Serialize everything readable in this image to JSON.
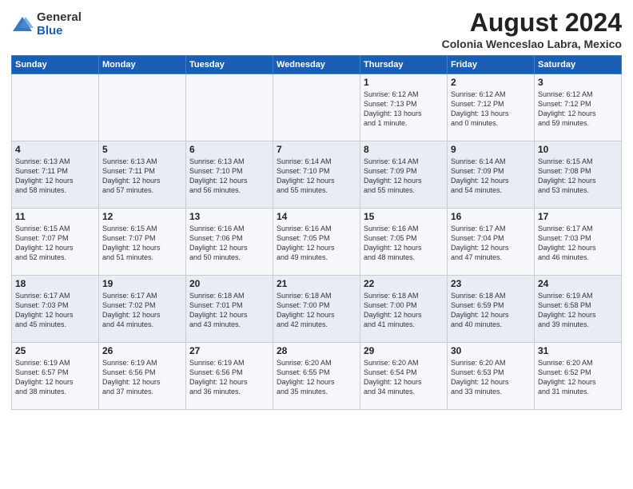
{
  "logo": {
    "general": "General",
    "blue": "Blue"
  },
  "title": "August 2024",
  "location": "Colonia Wenceslao Labra, Mexico",
  "days_of_week": [
    "Sunday",
    "Monday",
    "Tuesday",
    "Wednesday",
    "Thursday",
    "Friday",
    "Saturday"
  ],
  "weeks": [
    [
      {
        "day": "",
        "content": ""
      },
      {
        "day": "",
        "content": ""
      },
      {
        "day": "",
        "content": ""
      },
      {
        "day": "",
        "content": ""
      },
      {
        "day": "1",
        "content": "Sunrise: 6:12 AM\nSunset: 7:13 PM\nDaylight: 13 hours\nand 1 minute."
      },
      {
        "day": "2",
        "content": "Sunrise: 6:12 AM\nSunset: 7:12 PM\nDaylight: 13 hours\nand 0 minutes."
      },
      {
        "day": "3",
        "content": "Sunrise: 6:12 AM\nSunset: 7:12 PM\nDaylight: 12 hours\nand 59 minutes."
      }
    ],
    [
      {
        "day": "4",
        "content": "Sunrise: 6:13 AM\nSunset: 7:11 PM\nDaylight: 12 hours\nand 58 minutes."
      },
      {
        "day": "5",
        "content": "Sunrise: 6:13 AM\nSunset: 7:11 PM\nDaylight: 12 hours\nand 57 minutes."
      },
      {
        "day": "6",
        "content": "Sunrise: 6:13 AM\nSunset: 7:10 PM\nDaylight: 12 hours\nand 56 minutes."
      },
      {
        "day": "7",
        "content": "Sunrise: 6:14 AM\nSunset: 7:10 PM\nDaylight: 12 hours\nand 55 minutes."
      },
      {
        "day": "8",
        "content": "Sunrise: 6:14 AM\nSunset: 7:09 PM\nDaylight: 12 hours\nand 55 minutes."
      },
      {
        "day": "9",
        "content": "Sunrise: 6:14 AM\nSunset: 7:09 PM\nDaylight: 12 hours\nand 54 minutes."
      },
      {
        "day": "10",
        "content": "Sunrise: 6:15 AM\nSunset: 7:08 PM\nDaylight: 12 hours\nand 53 minutes."
      }
    ],
    [
      {
        "day": "11",
        "content": "Sunrise: 6:15 AM\nSunset: 7:07 PM\nDaylight: 12 hours\nand 52 minutes."
      },
      {
        "day": "12",
        "content": "Sunrise: 6:15 AM\nSunset: 7:07 PM\nDaylight: 12 hours\nand 51 minutes."
      },
      {
        "day": "13",
        "content": "Sunrise: 6:16 AM\nSunset: 7:06 PM\nDaylight: 12 hours\nand 50 minutes."
      },
      {
        "day": "14",
        "content": "Sunrise: 6:16 AM\nSunset: 7:05 PM\nDaylight: 12 hours\nand 49 minutes."
      },
      {
        "day": "15",
        "content": "Sunrise: 6:16 AM\nSunset: 7:05 PM\nDaylight: 12 hours\nand 48 minutes."
      },
      {
        "day": "16",
        "content": "Sunrise: 6:17 AM\nSunset: 7:04 PM\nDaylight: 12 hours\nand 47 minutes."
      },
      {
        "day": "17",
        "content": "Sunrise: 6:17 AM\nSunset: 7:03 PM\nDaylight: 12 hours\nand 46 minutes."
      }
    ],
    [
      {
        "day": "18",
        "content": "Sunrise: 6:17 AM\nSunset: 7:03 PM\nDaylight: 12 hours\nand 45 minutes."
      },
      {
        "day": "19",
        "content": "Sunrise: 6:17 AM\nSunset: 7:02 PM\nDaylight: 12 hours\nand 44 minutes."
      },
      {
        "day": "20",
        "content": "Sunrise: 6:18 AM\nSunset: 7:01 PM\nDaylight: 12 hours\nand 43 minutes."
      },
      {
        "day": "21",
        "content": "Sunrise: 6:18 AM\nSunset: 7:00 PM\nDaylight: 12 hours\nand 42 minutes."
      },
      {
        "day": "22",
        "content": "Sunrise: 6:18 AM\nSunset: 7:00 PM\nDaylight: 12 hours\nand 41 minutes."
      },
      {
        "day": "23",
        "content": "Sunrise: 6:18 AM\nSunset: 6:59 PM\nDaylight: 12 hours\nand 40 minutes."
      },
      {
        "day": "24",
        "content": "Sunrise: 6:19 AM\nSunset: 6:58 PM\nDaylight: 12 hours\nand 39 minutes."
      }
    ],
    [
      {
        "day": "25",
        "content": "Sunrise: 6:19 AM\nSunset: 6:57 PM\nDaylight: 12 hours\nand 38 minutes."
      },
      {
        "day": "26",
        "content": "Sunrise: 6:19 AM\nSunset: 6:56 PM\nDaylight: 12 hours\nand 37 minutes."
      },
      {
        "day": "27",
        "content": "Sunrise: 6:19 AM\nSunset: 6:56 PM\nDaylight: 12 hours\nand 36 minutes."
      },
      {
        "day": "28",
        "content": "Sunrise: 6:20 AM\nSunset: 6:55 PM\nDaylight: 12 hours\nand 35 minutes."
      },
      {
        "day": "29",
        "content": "Sunrise: 6:20 AM\nSunset: 6:54 PM\nDaylight: 12 hours\nand 34 minutes."
      },
      {
        "day": "30",
        "content": "Sunrise: 6:20 AM\nSunset: 6:53 PM\nDaylight: 12 hours\nand 33 minutes."
      },
      {
        "day": "31",
        "content": "Sunrise: 6:20 AM\nSunset: 6:52 PM\nDaylight: 12 hours\nand 31 minutes."
      }
    ]
  ]
}
